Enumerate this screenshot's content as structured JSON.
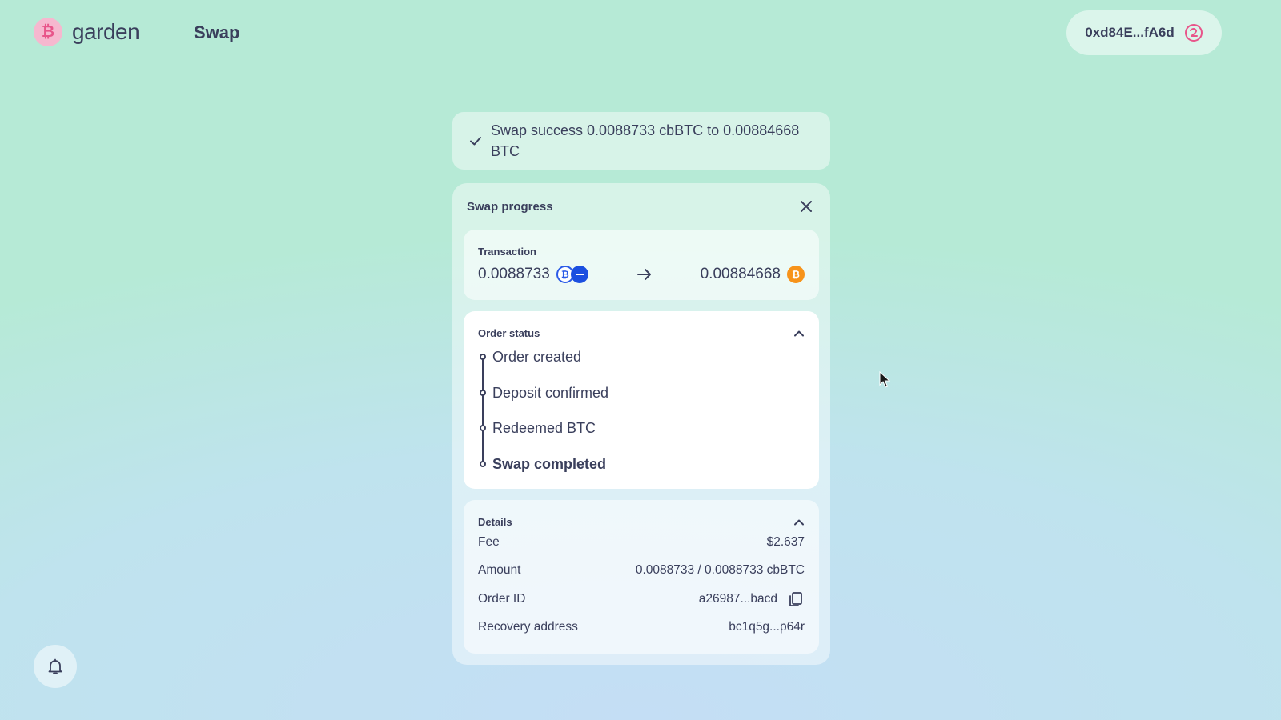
{
  "header": {
    "logo_text": "garden",
    "nav_label": "Swap",
    "wallet_address": "0xd84E...fA6d"
  },
  "toast": {
    "message": "Swap success 0.0088733 cbBTC to 0.00884668 BTC"
  },
  "panel": {
    "title": "Swap progress",
    "transaction": {
      "label": "Transaction",
      "from_amount": "0.0088733",
      "from_asset_icon": "cbbtc-base-icon",
      "to_amount": "0.00884668",
      "to_asset_icon": "btc-icon"
    },
    "order_status": {
      "label": "Order status",
      "steps": [
        {
          "label": "Order created"
        },
        {
          "label": "Deposit confirmed"
        },
        {
          "label": "Redeemed BTC"
        },
        {
          "label": "Swap completed"
        }
      ]
    },
    "details": {
      "label": "Details",
      "rows": [
        {
          "label": "Fee",
          "value": "$2.637"
        },
        {
          "label": "Amount",
          "value": "0.0088733 / 0.0088733 cbBTC"
        },
        {
          "label": "Order ID",
          "value": "a26987...bacd"
        },
        {
          "label": "Recovery address",
          "value": "bc1q5g...p64r"
        }
      ]
    }
  },
  "colors": {
    "text": "#3a3f5c",
    "brand_pink": "#e8558a",
    "btc_orange": "#f7931a",
    "cbbtc_blue": "#1b4fe0"
  }
}
